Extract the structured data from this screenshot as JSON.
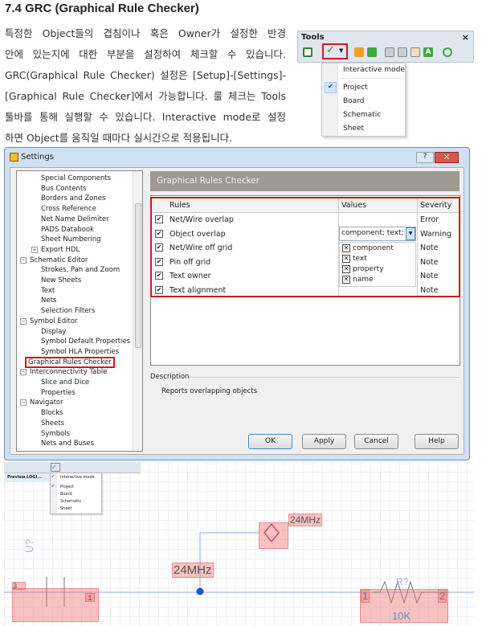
{
  "heading": "7.4 GRC (Graphical Rule Checker)",
  "paragraph": [
    "특정한 Object들의 겹침이나 혹은 Owner가 설정한 반경",
    "안에 있는지에 대한 부분을 설정하여 체크할 수 있습니다.",
    "GRC(Graphical Rule Checker) 설정은 [Setup]-[Settings]-",
    "[Graphical Rule Checker]에서 가능합니다. 룰 체크는 Tools",
    "툴바를 통해 실행할 수 있습니다. Interactive mode로 설정",
    "하면 Object를 움직일 때마다 실시간으로 적용됩니다."
  ],
  "tools": {
    "title": "Tools",
    "close": "×",
    "menu": {
      "interactive": "Interactive mode",
      "items": [
        "Project",
        "Board",
        "Schematic",
        "Sheet"
      ],
      "checked": "Project"
    }
  },
  "dialog": {
    "title": "Settings",
    "help": "?",
    "close": "×",
    "tree": [
      {
        "label": "Special Components",
        "level": 2
      },
      {
        "label": "Bus Contents",
        "level": 2
      },
      {
        "label": "Borders and Zones",
        "level": 2
      },
      {
        "label": "Cross Reference",
        "level": 2
      },
      {
        "label": "Net Name Delimiter",
        "level": 2
      },
      {
        "label": "PADS Databook",
        "level": 2
      },
      {
        "label": "Sheet Numbering",
        "level": 2
      },
      {
        "label": "Export HDL",
        "level": 2,
        "expander": "+"
      },
      {
        "label": "Schematic Editor",
        "level": 1,
        "expander": "−"
      },
      {
        "label": "Strokes, Pan and Zoom",
        "level": 2
      },
      {
        "label": "New Sheets",
        "level": 2
      },
      {
        "label": "Text",
        "level": 2
      },
      {
        "label": "Nets",
        "level": 2
      },
      {
        "label": "Selection Filters",
        "level": 2
      },
      {
        "label": "Symbol Editor",
        "level": 1,
        "expander": "−"
      },
      {
        "label": "Display",
        "level": 2
      },
      {
        "label": "Symbol Default Properties",
        "level": 2
      },
      {
        "label": "Symbol HLA Properties",
        "level": 2
      },
      {
        "label": "Graphical Rules Checker",
        "level": 1,
        "selected": true
      },
      {
        "label": "Interconnectivity Table",
        "level": 1,
        "expander": "−"
      },
      {
        "label": "Slice and Dice",
        "level": 2
      },
      {
        "label": "Properties",
        "level": 2
      },
      {
        "label": "Navigator",
        "level": 1,
        "expander": "−"
      },
      {
        "label": "Blocks",
        "level": 2
      },
      {
        "label": "Sheets",
        "level": 2
      },
      {
        "label": "Symbols",
        "level": 2
      },
      {
        "label": "Nets and Buses",
        "level": 2
      }
    ],
    "panel_title": "Graphical Rules Checker",
    "columns": [
      "Rules",
      "Values",
      "Severity"
    ],
    "rules": [
      {
        "rule": "Net/Wire overlap",
        "value": "",
        "severity": "Error",
        "checked": true
      },
      {
        "rule": "Object overlap",
        "value": "component; text; pr",
        "severity": "Warning",
        "checked": true
      },
      {
        "rule": "Net/Wire off grid",
        "value": "",
        "severity": "Note",
        "checked": true
      },
      {
        "rule": "Pin off grid",
        "value": "",
        "severity": "Note",
        "checked": true
      },
      {
        "rule": "Text owner",
        "value": "",
        "severity": "Note",
        "checked": true
      },
      {
        "rule": "Text alignment",
        "value": "",
        "severity": "Note",
        "checked": true
      }
    ],
    "value_options": [
      {
        "label": "component",
        "checked": true
      },
      {
        "label": "text",
        "checked": true
      },
      {
        "label": "property",
        "checked": true
      },
      {
        "label": "name",
        "checked": true
      }
    ],
    "description_label": "Description",
    "description": "Reports overlapping objects",
    "buttons": {
      "ok": "OK",
      "apply": "Apply",
      "cancel": "Cancel",
      "help": "Help"
    }
  },
  "schematic": {
    "tab": "Preview.LOGI...",
    "menu": {
      "interactive": "Interactive mode",
      "items": [
        "Project",
        "Board",
        "Schematic",
        "Sheet"
      ]
    },
    "ref_u": "U?",
    "cap_pin_left": "3",
    "cap_pin_right": "1",
    "net_label": "24MHz",
    "port_label": "24MHz",
    "ref_r": "R?",
    "res_pin_left": "1",
    "res_pin_right": "2",
    "res_value": "10K"
  },
  "colors": {
    "highlight": "#d01820",
    "wire": "#7da3e0",
    "junction": "#1a56d6"
  }
}
